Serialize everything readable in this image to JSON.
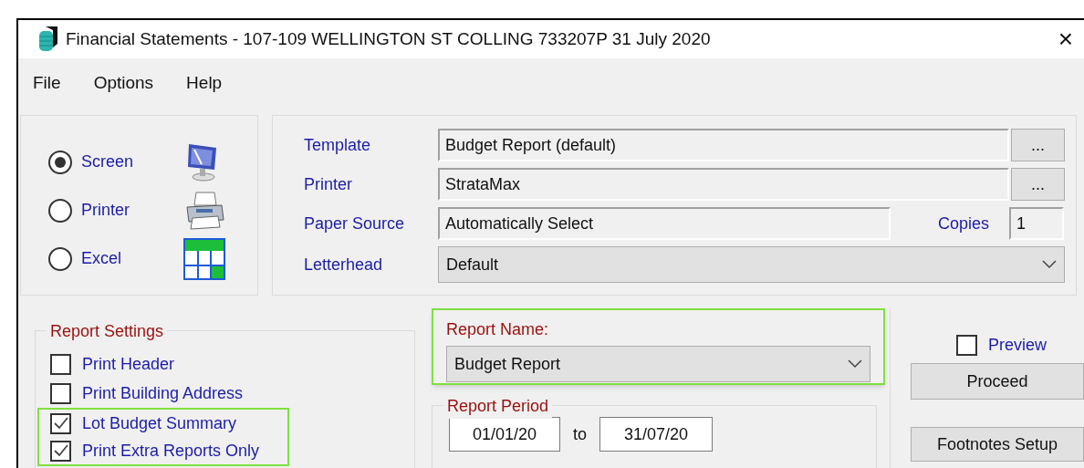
{
  "window": {
    "title": "Financial Statements - 107-109 WELLINGTON ST COLLING 733207P 31 July 2020",
    "close": "×"
  },
  "menu": [
    "File",
    "Options",
    "Help"
  ],
  "output": [
    {
      "label": "Screen",
      "kind": "screen",
      "selected": true
    },
    {
      "label": "Printer",
      "kind": "printer",
      "selected": false
    },
    {
      "label": "Excel",
      "kind": "excel",
      "selected": false
    }
  ],
  "settings": {
    "template": {
      "label": "Template",
      "value": "Budget Report (default)",
      "button": "..."
    },
    "printer": {
      "label": "Printer",
      "value": "StrataMax",
      "button": "..."
    },
    "paper_source": {
      "label": "Paper Source",
      "value": "Automatically Select"
    },
    "copies": {
      "label": "Copies",
      "value": "1"
    },
    "letterhead": {
      "label": "Letterhead",
      "value": "Default"
    }
  },
  "report_settings": {
    "title": "Report Settings",
    "items": [
      {
        "label": "Print Header",
        "checked": false,
        "highlighted": false
      },
      {
        "label": "Print Building Address",
        "checked": false,
        "highlighted": false
      },
      {
        "label": "Lot Budget Summary",
        "checked": true,
        "highlighted": true
      },
      {
        "label": "Print Extra Reports Only",
        "checked": true,
        "highlighted": true
      }
    ]
  },
  "report_name": {
    "label": "Report Name:",
    "value": "Budget Report",
    "highlighted": true
  },
  "report_period": {
    "title": "Report Period",
    "from": "01/01/20",
    "separator": "to",
    "to": "31/07/20"
  },
  "preview": {
    "label": "Preview",
    "checked": false
  },
  "buttons": [
    "Proceed",
    "Footnotes Setup"
  ]
}
